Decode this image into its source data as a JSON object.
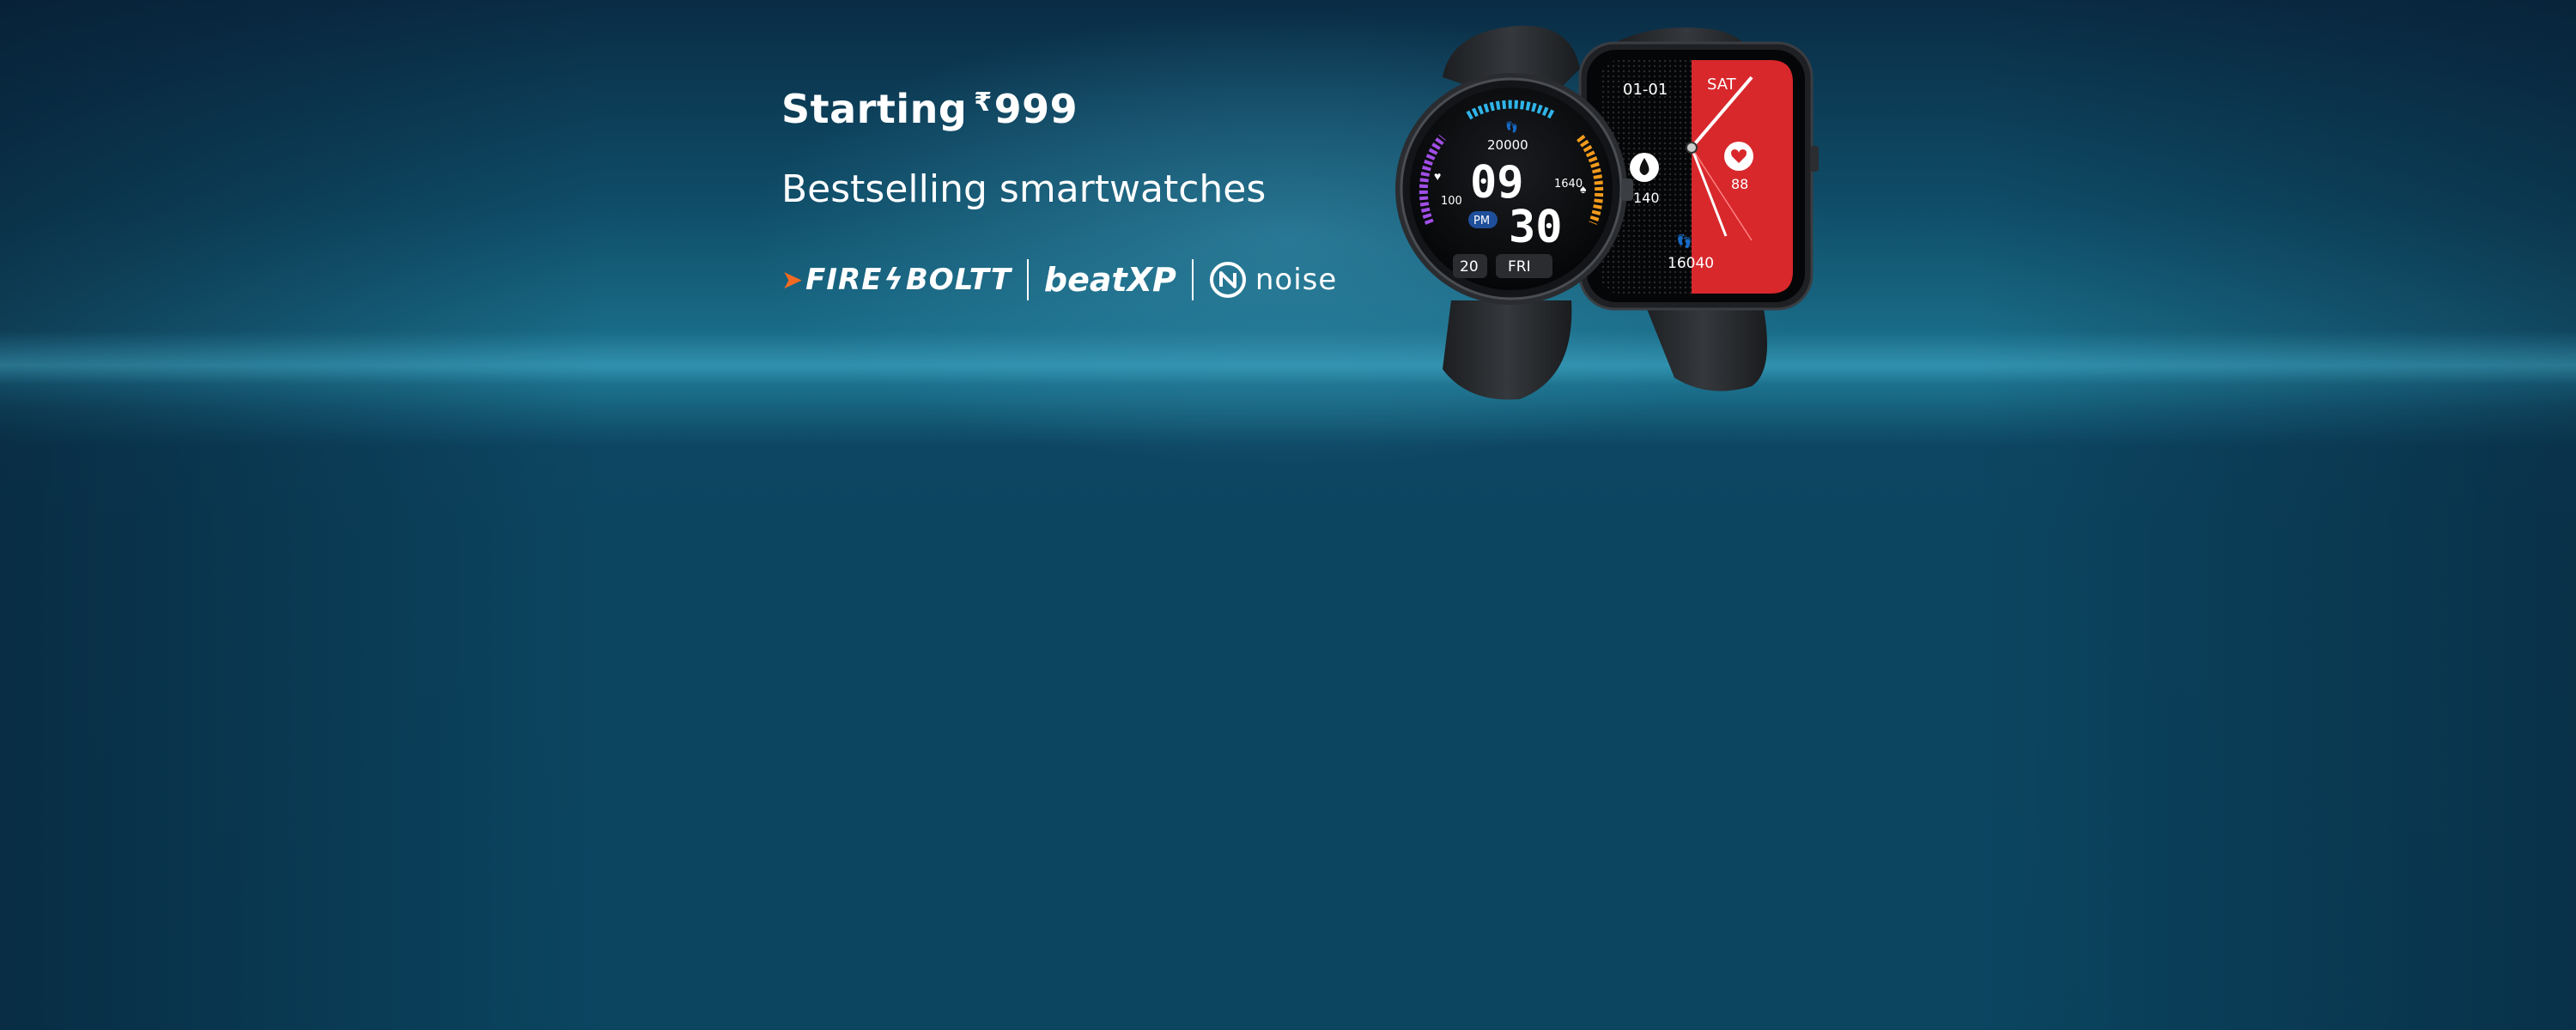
{
  "banner": {
    "price_prefix": "Starting",
    "currency": "₹",
    "price": "999",
    "subtitle": "Bestselling smartwatches",
    "brands": [
      "FIRE",
      "BOLTT",
      "beatXP",
      "noise"
    ]
  },
  "round_watch": {
    "hour": "09",
    "minute": "30",
    "ampm": "PM",
    "steps": "20000",
    "left_value": "100",
    "right_value": "1640",
    "date": "20",
    "day": "FRI"
  },
  "square_watch": {
    "date": "01-01",
    "day": "SAT",
    "left_value": "140",
    "right_value": "88",
    "steps": "16040"
  },
  "colors": {
    "accent_red": "#d8282c",
    "flame_orange": "#f26a21",
    "background": "#0b3e55"
  }
}
